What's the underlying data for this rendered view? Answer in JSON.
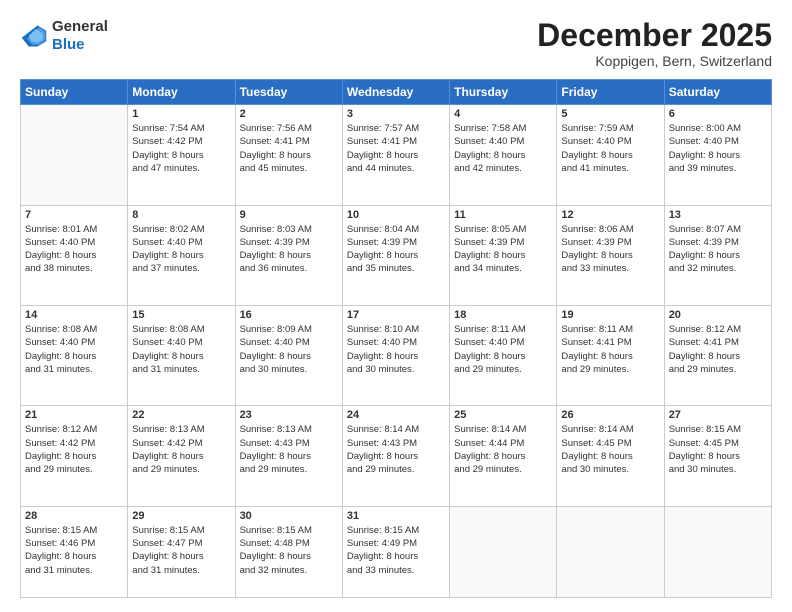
{
  "logo": {
    "general": "General",
    "blue": "Blue"
  },
  "header": {
    "month": "December 2025",
    "location": "Koppigen, Bern, Switzerland"
  },
  "weekdays": [
    "Sunday",
    "Monday",
    "Tuesday",
    "Wednesday",
    "Thursday",
    "Friday",
    "Saturday"
  ],
  "weeks": [
    [
      {
        "day": "",
        "info": ""
      },
      {
        "day": "1",
        "info": "Sunrise: 7:54 AM\nSunset: 4:42 PM\nDaylight: 8 hours\nand 47 minutes."
      },
      {
        "day": "2",
        "info": "Sunrise: 7:56 AM\nSunset: 4:41 PM\nDaylight: 8 hours\nand 45 minutes."
      },
      {
        "day": "3",
        "info": "Sunrise: 7:57 AM\nSunset: 4:41 PM\nDaylight: 8 hours\nand 44 minutes."
      },
      {
        "day": "4",
        "info": "Sunrise: 7:58 AM\nSunset: 4:40 PM\nDaylight: 8 hours\nand 42 minutes."
      },
      {
        "day": "5",
        "info": "Sunrise: 7:59 AM\nSunset: 4:40 PM\nDaylight: 8 hours\nand 41 minutes."
      },
      {
        "day": "6",
        "info": "Sunrise: 8:00 AM\nSunset: 4:40 PM\nDaylight: 8 hours\nand 39 minutes."
      }
    ],
    [
      {
        "day": "7",
        "info": "Sunrise: 8:01 AM\nSunset: 4:40 PM\nDaylight: 8 hours\nand 38 minutes."
      },
      {
        "day": "8",
        "info": "Sunrise: 8:02 AM\nSunset: 4:40 PM\nDaylight: 8 hours\nand 37 minutes."
      },
      {
        "day": "9",
        "info": "Sunrise: 8:03 AM\nSunset: 4:39 PM\nDaylight: 8 hours\nand 36 minutes."
      },
      {
        "day": "10",
        "info": "Sunrise: 8:04 AM\nSunset: 4:39 PM\nDaylight: 8 hours\nand 35 minutes."
      },
      {
        "day": "11",
        "info": "Sunrise: 8:05 AM\nSunset: 4:39 PM\nDaylight: 8 hours\nand 34 minutes."
      },
      {
        "day": "12",
        "info": "Sunrise: 8:06 AM\nSunset: 4:39 PM\nDaylight: 8 hours\nand 33 minutes."
      },
      {
        "day": "13",
        "info": "Sunrise: 8:07 AM\nSunset: 4:39 PM\nDaylight: 8 hours\nand 32 minutes."
      }
    ],
    [
      {
        "day": "14",
        "info": "Sunrise: 8:08 AM\nSunset: 4:40 PM\nDaylight: 8 hours\nand 31 minutes."
      },
      {
        "day": "15",
        "info": "Sunrise: 8:08 AM\nSunset: 4:40 PM\nDaylight: 8 hours\nand 31 minutes."
      },
      {
        "day": "16",
        "info": "Sunrise: 8:09 AM\nSunset: 4:40 PM\nDaylight: 8 hours\nand 30 minutes."
      },
      {
        "day": "17",
        "info": "Sunrise: 8:10 AM\nSunset: 4:40 PM\nDaylight: 8 hours\nand 30 minutes."
      },
      {
        "day": "18",
        "info": "Sunrise: 8:11 AM\nSunset: 4:40 PM\nDaylight: 8 hours\nand 29 minutes."
      },
      {
        "day": "19",
        "info": "Sunrise: 8:11 AM\nSunset: 4:41 PM\nDaylight: 8 hours\nand 29 minutes."
      },
      {
        "day": "20",
        "info": "Sunrise: 8:12 AM\nSunset: 4:41 PM\nDaylight: 8 hours\nand 29 minutes."
      }
    ],
    [
      {
        "day": "21",
        "info": "Sunrise: 8:12 AM\nSunset: 4:42 PM\nDaylight: 8 hours\nand 29 minutes."
      },
      {
        "day": "22",
        "info": "Sunrise: 8:13 AM\nSunset: 4:42 PM\nDaylight: 8 hours\nand 29 minutes."
      },
      {
        "day": "23",
        "info": "Sunrise: 8:13 AM\nSunset: 4:43 PM\nDaylight: 8 hours\nand 29 minutes."
      },
      {
        "day": "24",
        "info": "Sunrise: 8:14 AM\nSunset: 4:43 PM\nDaylight: 8 hours\nand 29 minutes."
      },
      {
        "day": "25",
        "info": "Sunrise: 8:14 AM\nSunset: 4:44 PM\nDaylight: 8 hours\nand 29 minutes."
      },
      {
        "day": "26",
        "info": "Sunrise: 8:14 AM\nSunset: 4:45 PM\nDaylight: 8 hours\nand 30 minutes."
      },
      {
        "day": "27",
        "info": "Sunrise: 8:15 AM\nSunset: 4:45 PM\nDaylight: 8 hours\nand 30 minutes."
      }
    ],
    [
      {
        "day": "28",
        "info": "Sunrise: 8:15 AM\nSunset: 4:46 PM\nDaylight: 8 hours\nand 31 minutes."
      },
      {
        "day": "29",
        "info": "Sunrise: 8:15 AM\nSunset: 4:47 PM\nDaylight: 8 hours\nand 31 minutes."
      },
      {
        "day": "30",
        "info": "Sunrise: 8:15 AM\nSunset: 4:48 PM\nDaylight: 8 hours\nand 32 minutes."
      },
      {
        "day": "31",
        "info": "Sunrise: 8:15 AM\nSunset: 4:49 PM\nDaylight: 8 hours\nand 33 minutes."
      },
      {
        "day": "",
        "info": ""
      },
      {
        "day": "",
        "info": ""
      },
      {
        "day": "",
        "info": ""
      }
    ]
  ]
}
